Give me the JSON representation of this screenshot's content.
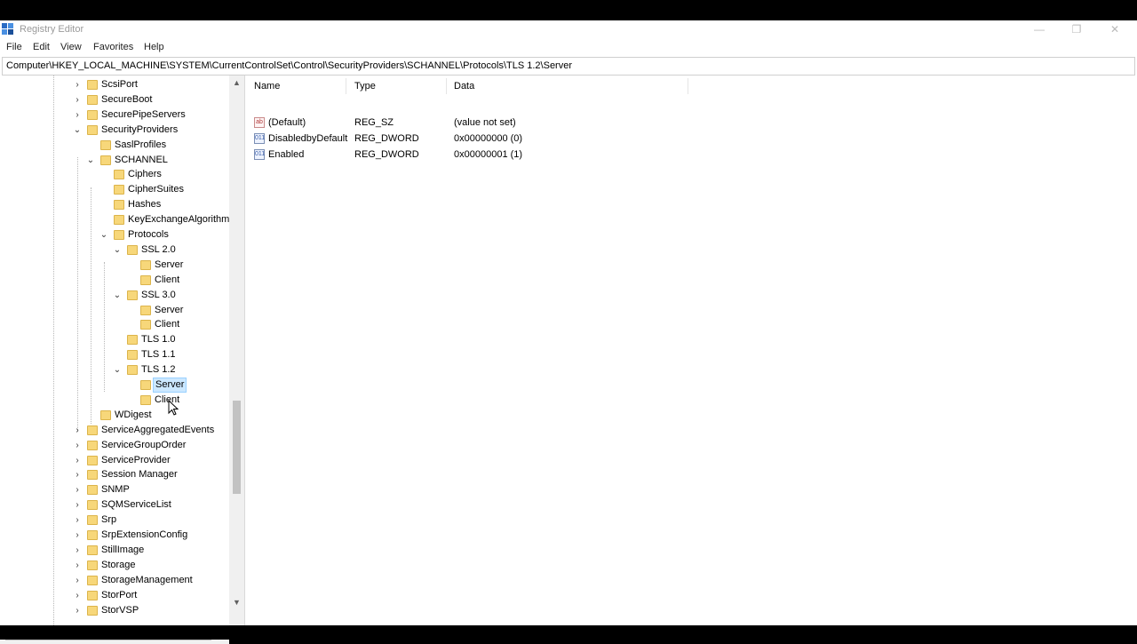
{
  "window": {
    "title": "Registry Editor",
    "controls": {
      "minimize": "—",
      "restore": "❐",
      "close": "✕"
    }
  },
  "menu": [
    "File",
    "Edit",
    "View",
    "Favorites",
    "Help"
  ],
  "address": "Computer\\HKEY_LOCAL_MACHINE\\SYSTEM\\CurrentControlSet\\Control\\SecurityProviders\\SCHANNEL\\Protocols\\TLS 1.2\\Server",
  "tree": [
    {
      "label": "ScsiPort",
      "level": 0,
      "toggle": "›"
    },
    {
      "label": "SecureBoot",
      "level": 0,
      "toggle": "›"
    },
    {
      "label": "SecurePipeServers",
      "level": 0,
      "toggle": "›"
    },
    {
      "label": "SecurityProviders",
      "level": 0,
      "toggle": "⌄"
    },
    {
      "label": "SaslProfiles",
      "level": 1,
      "toggle": ""
    },
    {
      "label": "SCHANNEL",
      "level": 1,
      "toggle": "⌄"
    },
    {
      "label": "Ciphers",
      "level": 2,
      "toggle": ""
    },
    {
      "label": "CipherSuites",
      "level": 2,
      "toggle": ""
    },
    {
      "label": "Hashes",
      "level": 2,
      "toggle": ""
    },
    {
      "label": "KeyExchangeAlgorithm",
      "level": 2,
      "toggle": ""
    },
    {
      "label": "Protocols",
      "level": 2,
      "toggle": "⌄"
    },
    {
      "label": "SSL 2.0",
      "level": 3,
      "toggle": "⌄"
    },
    {
      "label": "Server",
      "level": 4,
      "toggle": ""
    },
    {
      "label": "Client",
      "level": 4,
      "toggle": ""
    },
    {
      "label": "SSL 3.0",
      "level": 3,
      "toggle": "⌄"
    },
    {
      "label": "Server",
      "level": 4,
      "toggle": ""
    },
    {
      "label": "Client",
      "level": 4,
      "toggle": ""
    },
    {
      "label": "TLS 1.0",
      "level": 3,
      "toggle": ""
    },
    {
      "label": "TLS 1.1",
      "level": 3,
      "toggle": ""
    },
    {
      "label": "TLS 1.2",
      "level": 3,
      "toggle": "⌄"
    },
    {
      "label": "Server",
      "level": 4,
      "toggle": "",
      "selected": true
    },
    {
      "label": "Client",
      "level": 4,
      "toggle": ""
    },
    {
      "label": "WDigest",
      "level": 1,
      "toggle": ""
    },
    {
      "label": "ServiceAggregatedEvents",
      "level": 0,
      "toggle": "›"
    },
    {
      "label": "ServiceGroupOrder",
      "level": 0,
      "toggle": "›"
    },
    {
      "label": "ServiceProvider",
      "level": 0,
      "toggle": "›"
    },
    {
      "label": "Session Manager",
      "level": 0,
      "toggle": "›"
    },
    {
      "label": "SNMP",
      "level": 0,
      "toggle": "›"
    },
    {
      "label": "SQMServiceList",
      "level": 0,
      "toggle": "›"
    },
    {
      "label": "Srp",
      "level": 0,
      "toggle": "›"
    },
    {
      "label": "SrpExtensionConfig",
      "level": 0,
      "toggle": "›"
    },
    {
      "label": "StillImage",
      "level": 0,
      "toggle": "›"
    },
    {
      "label": "Storage",
      "level": 0,
      "toggle": "›"
    },
    {
      "label": "StorageManagement",
      "level": 0,
      "toggle": "›"
    },
    {
      "label": "StorPort",
      "level": 0,
      "toggle": "›"
    },
    {
      "label": "StorVSP",
      "level": 0,
      "toggle": "›"
    }
  ],
  "columns": {
    "name": "Name",
    "type": "Type",
    "data": "Data"
  },
  "values": [
    {
      "icon": "ab",
      "kind": "string-value-icon",
      "name": "(Default)",
      "type": "REG_SZ",
      "data": "(value not set)"
    },
    {
      "icon": "011",
      "kind": "dword-value-icon",
      "name": "DisabledbyDefault",
      "type": "REG_DWORD",
      "data": "0x00000000 (0)"
    },
    {
      "icon": "011",
      "kind": "dword-value-icon",
      "name": "Enabled",
      "type": "REG_DWORD",
      "data": "0x00000001 (1)"
    }
  ],
  "scroll": {
    "up": "▲",
    "down": "▼",
    "left": "◀",
    "right": "▶"
  }
}
